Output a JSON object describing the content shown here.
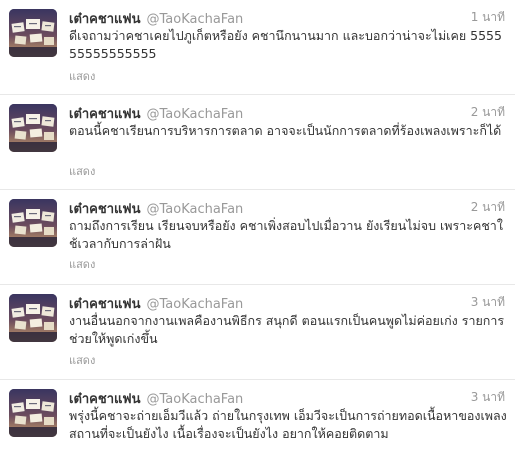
{
  "tweets": [
    {
      "fullname": "เต๋าคชาแฟน",
      "username": "@TaoKachaFan",
      "time": "1 นาที",
      "text": "ดีเจถามว่าคชาเคยไปภูเก็ตหรือยัง คชานึกนานมาก และบอกว่าน่าจะไม่เคย 555555555555555",
      "expand": "แสดง"
    },
    {
      "fullname": "เต๋าคชาแฟน",
      "username": "@TaoKachaFan",
      "time": "2 นาที",
      "text": "ตอนนี้คชาเรียนการบริหารการตลาด อาจจะเป็นนักการตลาดที่ร้องเพลงเพราะก็ได้",
      "expand": "แสดง"
    },
    {
      "fullname": "เต๋าคชาแฟน",
      "username": "@TaoKachaFan",
      "time": "2 นาที",
      "text": "ถามถึงการเรียน เรียนจบหรือยัง คชาเพิ่งสอบไปเมื่อวาน ยังเรียนไม่จบ เพราะคชาใช้เวลากับการล่าฝัน",
      "expand": "แสดง"
    },
    {
      "fullname": "เต๋าคชาแฟน",
      "username": "@TaoKachaFan",
      "time": "3 นาที",
      "text": "งานอื่นนอกจากงานเพลคืองานพิธีกร สนุกดี ตอนแรกเป็นคนพูดไม่ค่อยเก่ง รายการช่วยให้พูดเก่งขึ้น",
      "expand": "แสดง"
    },
    {
      "fullname": "เต๋าคชาแฟน",
      "username": "@TaoKachaFan",
      "time": "3 นาที",
      "text": "พรุ่งนี้คชาจะถ่ายเอ็มวีแล้ว ถ่ายในกรุงเทพ เอ็มวีจะเป็นการถ่ายทอดเนื้อหาของเพลง สถานที่จะเป็นยังไง เนื้อเรื่องจะเป็นยังไง อยากให้คอยติดตาม"
    }
  ]
}
